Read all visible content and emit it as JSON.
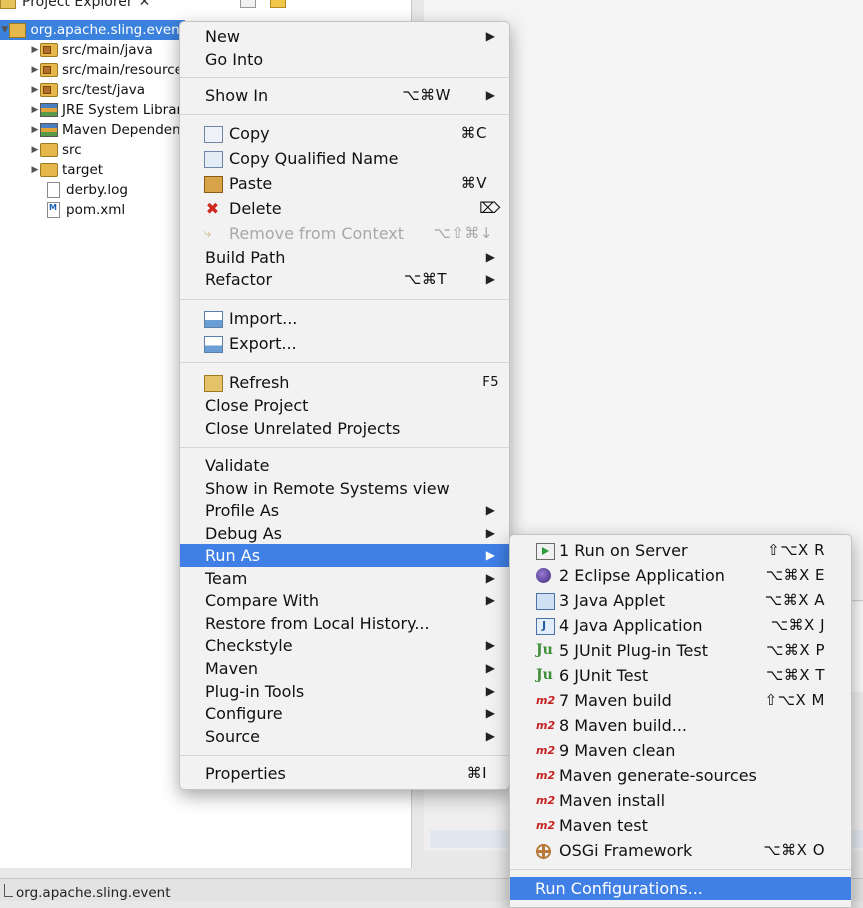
{
  "explorer": {
    "title": "Project Explorer",
    "close": "✕",
    "tree": [
      {
        "label": "org.apache.sling.event",
        "icon": "project-icon",
        "selected": true
      },
      {
        "label": "src/main/java",
        "icon": "package-folder-icon"
      },
      {
        "label": "src/main/resources",
        "icon": "package-folder-icon"
      },
      {
        "label": "src/test/java",
        "icon": "package-folder-icon"
      },
      {
        "label": "JRE System Library",
        "icon": "library-icon"
      },
      {
        "label": "Maven Dependencies",
        "icon": "library-icon"
      },
      {
        "label": "src",
        "icon": "folder-icon"
      },
      {
        "label": "target",
        "icon": "folder-icon"
      },
      {
        "label": "derby.log",
        "icon": "file-icon"
      },
      {
        "label": "pom.xml",
        "icon": "maven-file-icon"
      }
    ]
  },
  "context_menu": {
    "items": {
      "new": "New",
      "go_into": "Go Into",
      "show_in": "Show In",
      "show_in_sc": "⌥⌘W",
      "copy": "Copy",
      "copy_sc": "⌘C",
      "copy_qualified": "Copy Qualified Name",
      "paste": "Paste",
      "paste_sc": "⌘V",
      "delete": "Delete",
      "delete_sc": "⌦",
      "remove_context": "Remove from Context",
      "remove_context_sc": "⌥⇧⌘↓",
      "build_path": "Build Path",
      "refactor": "Refactor",
      "refactor_sc": "⌥⌘T",
      "import": "Import...",
      "export": "Export...",
      "refresh": "Refresh",
      "refresh_sc": "F5",
      "close_project": "Close Project",
      "close_unrelated": "Close Unrelated Projects",
      "validate": "Validate",
      "show_remote": "Show in Remote Systems view",
      "profile_as": "Profile As",
      "debug_as": "Debug As",
      "run_as": "Run As",
      "team": "Team",
      "compare_with": "Compare With",
      "restore_history": "Restore from Local History...",
      "checkstyle": "Checkstyle",
      "maven": "Maven",
      "plugin_tools": "Plug-in Tools",
      "configure": "Configure",
      "source": "Source",
      "properties": "Properties",
      "properties_sc": "⌘I"
    }
  },
  "run_as_menu": {
    "items": [
      {
        "label": "1 Run on Server",
        "shortcut": "⇧⌥X R"
      },
      {
        "label": "2 Eclipse Application",
        "shortcut": "⌥⌘X E"
      },
      {
        "label": "3 Java Applet",
        "shortcut": "⌥⌘X A"
      },
      {
        "label": "4 Java Application",
        "shortcut": "⌥⌘X J"
      },
      {
        "label": "5 JUnit Plug-in Test",
        "shortcut": "⌥⌘X P"
      },
      {
        "label": "6 JUnit Test",
        "shortcut": "⌥⌘X T"
      },
      {
        "label": "7 Maven build",
        "shortcut": "⇧⌥X M"
      },
      {
        "label": "8 Maven build...",
        "shortcut": ""
      },
      {
        "label": "9 Maven clean",
        "shortcut": ""
      },
      {
        "label": "Maven generate-sources",
        "shortcut": ""
      },
      {
        "label": "Maven install",
        "shortcut": ""
      },
      {
        "label": "Maven test",
        "shortcut": ""
      },
      {
        "label": "OSGi Framework",
        "shortcut": "⌥⌘X O"
      },
      {
        "label": "Run Configurations...",
        "shortcut": ""
      }
    ],
    "m2_text": "m2",
    "junit_text": "Ju"
  },
  "status_bar": {
    "text": "org.apache.sling.event"
  },
  "colors": {
    "highlight": "#3f7fe6",
    "selection": "#3b82de",
    "menu_bg": "#f2f2f2"
  }
}
